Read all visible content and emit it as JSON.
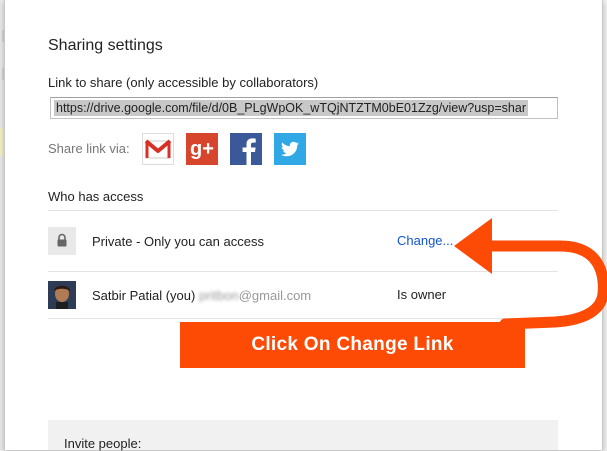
{
  "dialog": {
    "title": "Sharing settings",
    "link_label": "Link to share (only accessible by collaborators)",
    "link_value": "https://drive.google.com/file/d/0B_PLgWpOK_wTQjNTZTM0bE01Zzg/view?usp=shar",
    "share_via_label": "Share link via:",
    "share_icons": [
      "gmail-icon",
      "google-plus-icon",
      "facebook-icon",
      "twitter-icon"
    ],
    "gplus_glyph": "g+"
  },
  "access": {
    "heading": "Who has access",
    "private_row": {
      "icon": "lock-icon",
      "label": "Private - Only you can access",
      "action": "Change..."
    },
    "owner_row": {
      "name": "Satbir Patial (you)",
      "email_blurred": "pritbon",
      "email_domain": "@gmail.com",
      "role": "Is owner"
    }
  },
  "invite": {
    "label": "Invite people:"
  },
  "annotation": {
    "text": "Click On Change Link",
    "color": "#fd4a05"
  },
  "colors": {
    "link": "#1155cc",
    "gmail_red": "#d93025",
    "gplus": "#d7452d",
    "facebook": "#3b5998",
    "twitter": "#2fa8e5"
  }
}
